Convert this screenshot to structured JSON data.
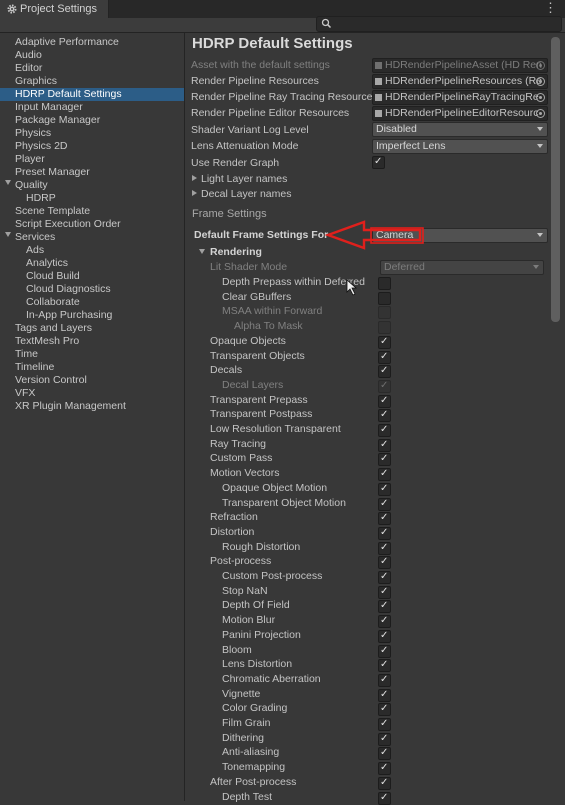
{
  "window": {
    "tab_title": "Project Settings",
    "menu_icon": "kebab-menu-icon",
    "search_placeholder": ""
  },
  "sidebar": {
    "items": [
      {
        "label": "Adaptive Performance",
        "indent": 0
      },
      {
        "label": "Audio",
        "indent": 0
      },
      {
        "label": "Editor",
        "indent": 0
      },
      {
        "label": "Graphics",
        "indent": 0
      },
      {
        "label": "HDRP Default Settings",
        "indent": 0,
        "selected": true
      },
      {
        "label": "Input Manager",
        "indent": 0
      },
      {
        "label": "Package Manager",
        "indent": 0
      },
      {
        "label": "Physics",
        "indent": 0
      },
      {
        "label": "Physics 2D",
        "indent": 0
      },
      {
        "label": "Player",
        "indent": 0
      },
      {
        "label": "Preset Manager",
        "indent": 0
      },
      {
        "label": "Quality",
        "indent": 0,
        "foldout": true
      },
      {
        "label": "HDRP",
        "indent": 1
      },
      {
        "label": "Scene Template",
        "indent": 0
      },
      {
        "label": "Script Execution Order",
        "indent": 0
      },
      {
        "label": "Services",
        "indent": 0,
        "foldout": true
      },
      {
        "label": "Ads",
        "indent": 1
      },
      {
        "label": "Analytics",
        "indent": 1
      },
      {
        "label": "Cloud Build",
        "indent": 1
      },
      {
        "label": "Cloud Diagnostics",
        "indent": 1
      },
      {
        "label": "Collaborate",
        "indent": 1
      },
      {
        "label": "In-App Purchasing",
        "indent": 1
      },
      {
        "label": "Tags and Layers",
        "indent": 0
      },
      {
        "label": "TextMesh Pro",
        "indent": 0
      },
      {
        "label": "Time",
        "indent": 0
      },
      {
        "label": "Timeline",
        "indent": 0
      },
      {
        "label": "Version Control",
        "indent": 0
      },
      {
        "label": "VFX",
        "indent": 0
      },
      {
        "label": "XR Plugin Management",
        "indent": 0
      }
    ]
  },
  "main": {
    "title": "HDRP Default Settings",
    "asset_label": "Asset with the default settings",
    "asset_value": "HDRenderPipelineAsset (HD Ren",
    "resources_label": "Render Pipeline Resources",
    "resources_value": "HDRenderPipelineResources (Re",
    "raytracing_label": "Render Pipeline Ray Tracing Resources",
    "raytracing_value": "HDRenderPipelineRayTracingRe",
    "editor_res_label": "Render Pipeline Editor Resources",
    "editor_res_value": "HDRenderPipelineEditorResourc",
    "shader_log_label": "Shader Variant Log Level",
    "shader_log_value": "Disabled",
    "lens_label": "Lens Attenuation Mode",
    "lens_value": "Imperfect Lens",
    "render_graph_label": "Use Render Graph",
    "render_graph_checked": true,
    "light_layers_label": "Light Layer names",
    "decal_layers_label": "Decal Layer names",
    "frame_settings_header": "Frame Settings",
    "default_for_label": "Default Frame Settings For",
    "default_for_value": "Camera",
    "rendering_header": "Rendering",
    "lit_shader_label": "Lit Shader Mode",
    "lit_shader_value": "Deferred",
    "settings": [
      {
        "label": "Depth Prepass within Deferred",
        "indent": 2,
        "checked": false,
        "dim_label": false,
        "dim_box": false
      },
      {
        "label": "Clear GBuffers",
        "indent": 2,
        "checked": false,
        "dim_label": false,
        "dim_box": false
      },
      {
        "label": "MSAA within Forward",
        "indent": 2,
        "checked": false,
        "dim_label": true,
        "dim_box": true
      },
      {
        "label": "Alpha To Mask",
        "indent": 3,
        "checked": false,
        "dim_label": true,
        "dim_box": true
      },
      {
        "label": "Opaque Objects",
        "indent": 1,
        "checked": true
      },
      {
        "label": "Transparent Objects",
        "indent": 1,
        "checked": true
      },
      {
        "label": "Decals",
        "indent": 1,
        "checked": true
      },
      {
        "label": "Decal Layers",
        "indent": 2,
        "checked": true,
        "dim_label": true,
        "dim_box": true
      },
      {
        "label": "Transparent Prepass",
        "indent": 1,
        "checked": true
      },
      {
        "label": "Transparent Postpass",
        "indent": 1,
        "checked": true
      },
      {
        "label": "Low Resolution Transparent",
        "indent": 1,
        "checked": true
      },
      {
        "label": "Ray Tracing",
        "indent": 1,
        "checked": true
      },
      {
        "label": "Custom Pass",
        "indent": 1,
        "checked": true
      },
      {
        "label": "Motion Vectors",
        "indent": 1,
        "checked": true
      },
      {
        "label": "Opaque Object Motion",
        "indent": 2,
        "checked": true
      },
      {
        "label": "Transparent Object Motion",
        "indent": 2,
        "checked": true
      },
      {
        "label": "Refraction",
        "indent": 1,
        "checked": true
      },
      {
        "label": "Distortion",
        "indent": 1,
        "checked": true
      },
      {
        "label": "Rough Distortion",
        "indent": 2,
        "checked": true
      },
      {
        "label": "Post-process",
        "indent": 1,
        "checked": true
      },
      {
        "label": "Custom Post-process",
        "indent": 2,
        "checked": true
      },
      {
        "label": "Stop NaN",
        "indent": 2,
        "checked": true
      },
      {
        "label": "Depth Of Field",
        "indent": 2,
        "checked": true
      },
      {
        "label": "Motion Blur",
        "indent": 2,
        "checked": true
      },
      {
        "label": "Panini Projection",
        "indent": 2,
        "checked": true
      },
      {
        "label": "Bloom",
        "indent": 2,
        "checked": true
      },
      {
        "label": "Lens Distortion",
        "indent": 2,
        "checked": true
      },
      {
        "label": "Chromatic Aberration",
        "indent": 2,
        "checked": true
      },
      {
        "label": "Vignette",
        "indent": 2,
        "checked": true
      },
      {
        "label": "Color Grading",
        "indent": 2,
        "checked": true
      },
      {
        "label": "Film Grain",
        "indent": 2,
        "checked": true
      },
      {
        "label": "Dithering",
        "indent": 2,
        "checked": true
      },
      {
        "label": "Anti-aliasing",
        "indent": 2,
        "checked": true
      },
      {
        "label": "Tonemapping",
        "indent": 2,
        "checked": true
      },
      {
        "label": "After Post-process",
        "indent": 1,
        "checked": true
      },
      {
        "label": "Depth Test",
        "indent": 2,
        "checked": true
      }
    ]
  },
  "colors": {
    "selection": "#2c5d87",
    "annotation_red": "#e0201c",
    "background": "#383838"
  }
}
